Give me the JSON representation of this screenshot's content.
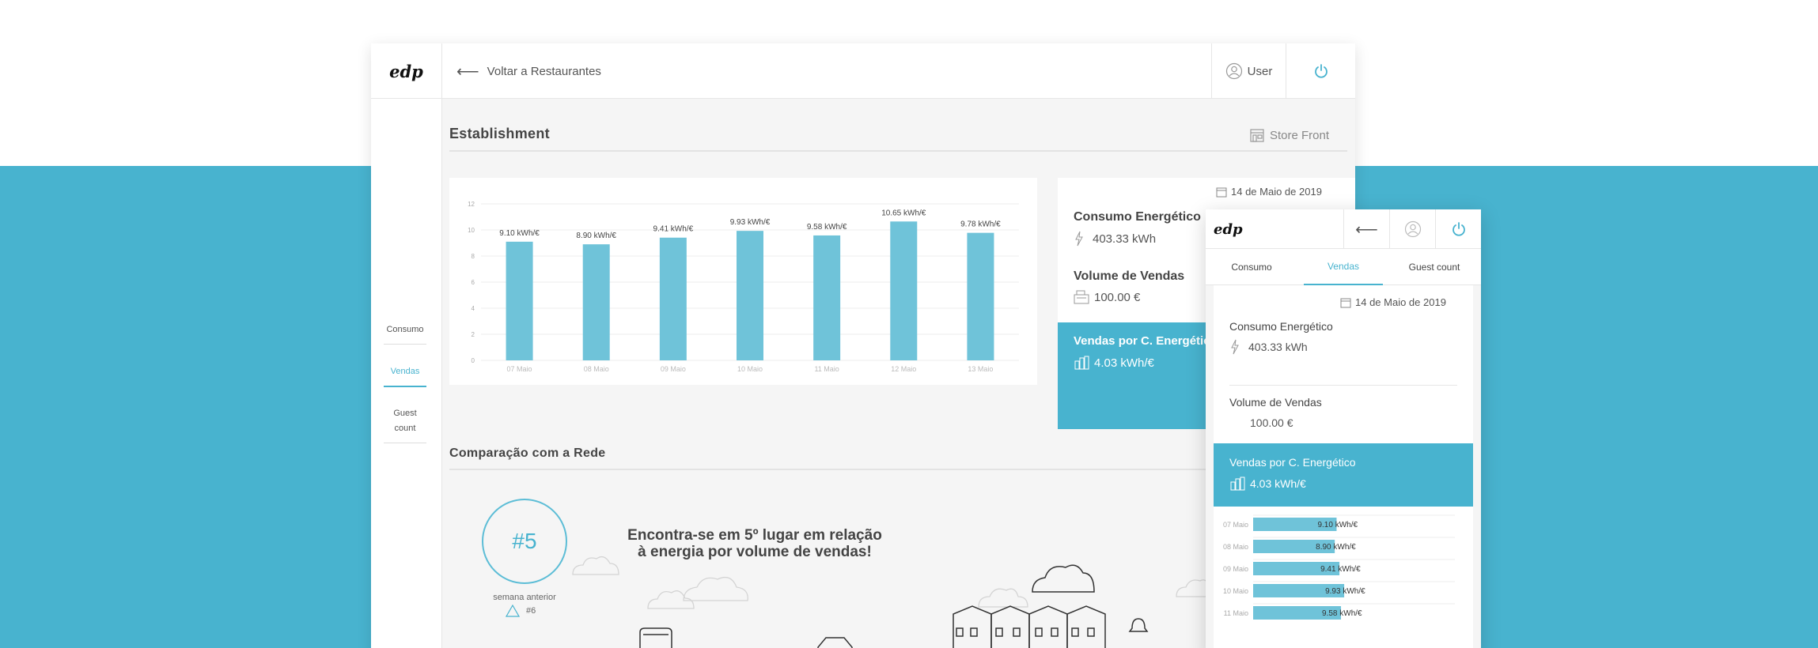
{
  "desktop": {
    "logo": "edp",
    "back_label": "Voltar a Restaurantes",
    "user_label": "User",
    "sidebar": {
      "items": [
        {
          "label": "Consumo"
        },
        {
          "label": "Vendas"
        },
        {
          "label": "Guest count"
        }
      ]
    },
    "section1_title": "Establishment",
    "store_front": "Store Front",
    "info": {
      "date": "14 de Maio de 2019",
      "consumo_label": "Consumo Energético",
      "consumo_value": "403.33 kWh",
      "vendas_label": "Volume de Vendas",
      "vendas_value": "100.00 €",
      "ratio_label": "Vendas por C. Energético",
      "ratio_value": "4.03 kWh/€"
    },
    "section2_title": "Comparação com a Rede",
    "rank": "#5",
    "rank_sub": "semana anterior",
    "rank_prev": "#6",
    "headline_line1": "Encontra-se em 5º lugar em relação",
    "headline_line2": "à energia por volume de vendas!"
  },
  "mobile": {
    "logo": "edp",
    "tabs": [
      {
        "label": "Consumo"
      },
      {
        "label": "Vendas"
      },
      {
        "label": "Guest count"
      }
    ],
    "date": "14 de Maio de 2019",
    "consumo_label": "Consumo Energético",
    "consumo_value": "403.33 kWh",
    "vendas_label": "Volume de Vendas",
    "vendas_value": "100.00 €",
    "ratio_label": "Vendas por C. Energético",
    "ratio_value": "4.03 kWh/€"
  },
  "colors": {
    "accent": "#48b3cf",
    "bar": "#6fc3d9",
    "band": "#48b3cf"
  },
  "icons": [
    "back-arrow-icon",
    "user-icon",
    "power-icon",
    "store-front-icon",
    "calendar-icon",
    "lightning-icon",
    "cash-register-icon",
    "coins-icon",
    "triangle-icon"
  ],
  "chart_data": [
    {
      "type": "bar",
      "categories": [
        "07 Maio",
        "08 Maio",
        "09 Maio",
        "10 Maio",
        "11 Maio",
        "12 Maio",
        "13 Maio"
      ],
      "values": [
        9.1,
        8.9,
        9.41,
        9.93,
        9.58,
        10.65,
        9.78
      ],
      "labels": [
        "9.10 kWh/€",
        "8.90 kWh/€",
        "9.41 kWh/€",
        "9.93 kWh/€",
        "9.58 kWh/€",
        "10.65 kWh/€",
        "9.78 kWh/€"
      ],
      "yticks": [
        "0",
        "2",
        "4",
        "6",
        "8",
        "10",
        "12"
      ],
      "ylim": [
        0,
        12
      ]
    },
    {
      "type": "bar",
      "orientation": "horizontal",
      "categories": [
        "07 Maio",
        "08 Maio",
        "09 Maio",
        "10 Maio",
        "11 Maio"
      ],
      "values": [
        9.1,
        8.9,
        9.41,
        9.93,
        9.58
      ],
      "labels": [
        "9.10 kWh/€",
        "8.90 kWh/€",
        "9.41 kWh/€",
        "9.93 kWh/€",
        "9.58 kWh/€"
      ]
    }
  ]
}
